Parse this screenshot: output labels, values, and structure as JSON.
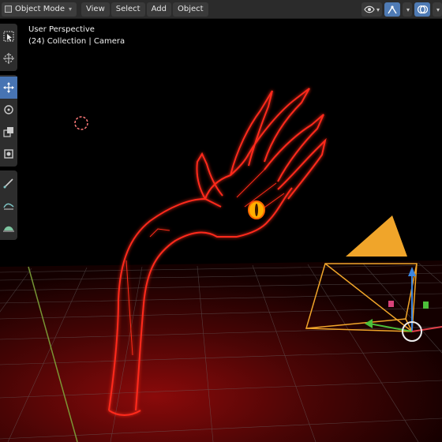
{
  "header": {
    "mode_label": "Object Mode",
    "menus": [
      "View",
      "Select",
      "Add",
      "Object"
    ]
  },
  "viewport": {
    "perspective_label": "User Perspective",
    "collection_label": "(24) Collection | Camera"
  },
  "toolbar": {
    "tools": [
      "select-box",
      "cursor",
      "move",
      "rotate",
      "scale",
      "transform",
      "annotate",
      "measure",
      "add-cube"
    ],
    "active_tool": "move"
  },
  "icons": {
    "visibility": "eye-icon",
    "gizmo": "gizmo-icon",
    "overlay": "overlay-icon"
  },
  "colors": {
    "accent": "#4f7bb5",
    "camera": "#f0a52a",
    "glow": "#ff2a1a"
  }
}
